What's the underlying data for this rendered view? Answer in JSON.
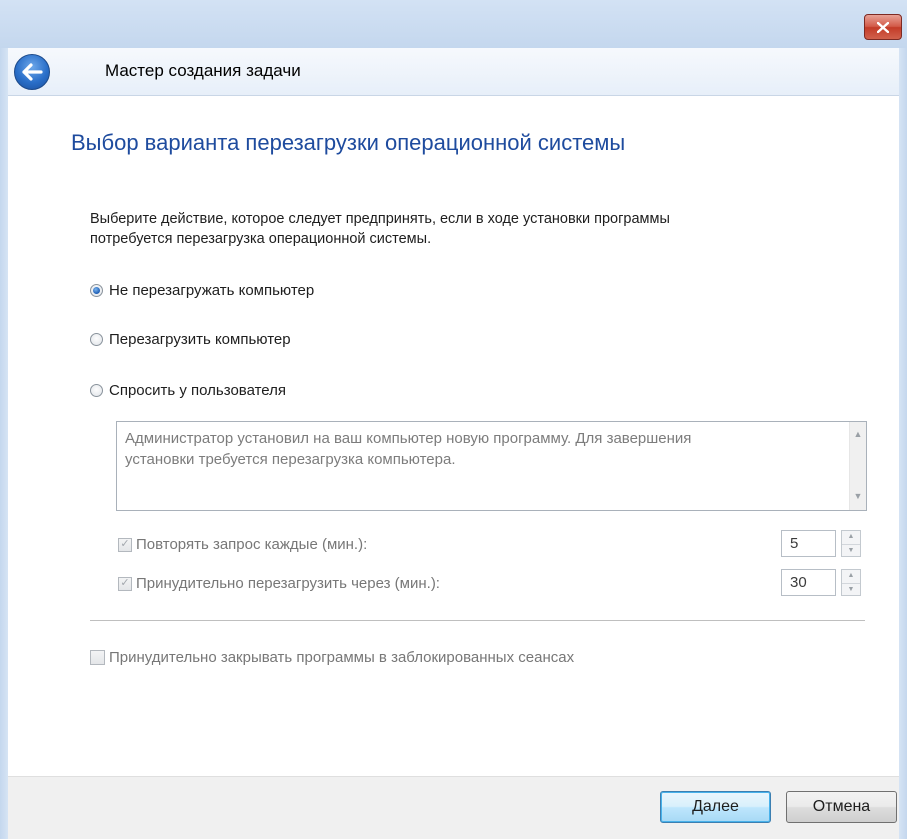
{
  "window": {
    "title": "Мастер создания задачи"
  },
  "page": {
    "heading": "Выбор варианта перезагрузки операционной системы",
    "instructions_line1": "Выберите действие, которое следует предпринять, если в ходе установки программы",
    "instructions_line2": "потребуется перезагрузка операционной системы."
  },
  "reboot_options": [
    {
      "label": "Не перезагружать компьютер",
      "checked": true
    },
    {
      "label": "Перезагрузить компьютер",
      "checked": false
    },
    {
      "label": "Спросить у пользователя",
      "checked": false
    }
  ],
  "message": {
    "line1": "Администратор установил на ваш компьютер новую программу. Для завершения",
    "line2": "установки требуется перезагрузка компьютера."
  },
  "repeat_request": {
    "label": "Повторять запрос каждые (мин.):",
    "checked": true,
    "value": "5"
  },
  "force_restart": {
    "label": "Принудительно перезагрузить через (мин.):",
    "checked": true,
    "value": "30"
  },
  "force_close": {
    "label": "Принудительно закрывать программы в заблокированных сеансах",
    "checked": false
  },
  "buttons": {
    "next": "Далее",
    "cancel": "Отмена"
  },
  "colors": {
    "heading": "#1e4b9e",
    "frame": "#c4d7ee",
    "close_button": "#c33b28"
  },
  "icons": {
    "back": "back-arrow-icon",
    "close": "close-icon",
    "check": "checkmark-icon",
    "scroll_up": "scroll-up-arrow-icon",
    "scroll_down": "scroll-down-arrow-icon",
    "spin_up": "spin-up-icon",
    "spin_down": "spin-down-icon"
  }
}
